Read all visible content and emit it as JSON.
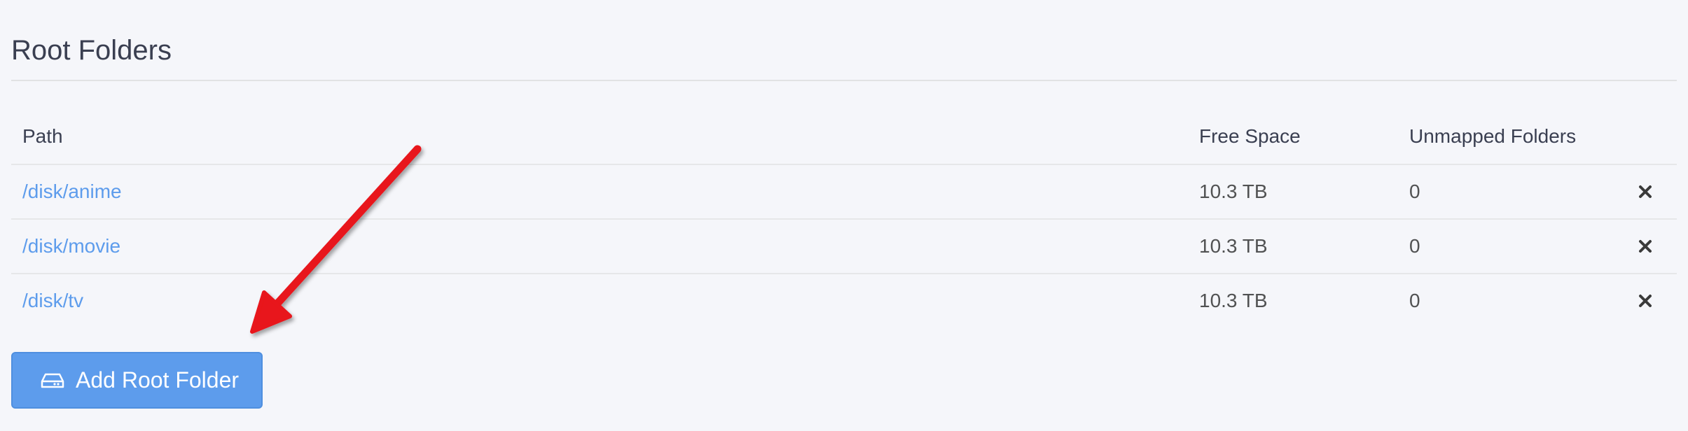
{
  "section": {
    "title": "Root Folders"
  },
  "table": {
    "headers": {
      "path": "Path",
      "free_space": "Free Space",
      "unmapped_folders": "Unmapped Folders"
    },
    "rows": [
      {
        "path": "/disk/anime",
        "free_space": "10.3 TB",
        "unmapped_folders": "0"
      },
      {
        "path": "/disk/movie",
        "free_space": "10.3 TB",
        "unmapped_folders": "0"
      },
      {
        "path": "/disk/tv",
        "free_space": "10.3 TB",
        "unmapped_folders": "0"
      }
    ],
    "row_action_icon": "close-icon"
  },
  "add_button": {
    "label": "Add Root Folder",
    "icon": "hard-drive-icon"
  },
  "annotation": {
    "type": "arrow",
    "color": "#e8131a",
    "points_to": "add_button"
  },
  "colors": {
    "background": "#f5f6fa",
    "link": "#5d9cec",
    "button": "#5d9cec",
    "annotation": "#e8131a"
  }
}
